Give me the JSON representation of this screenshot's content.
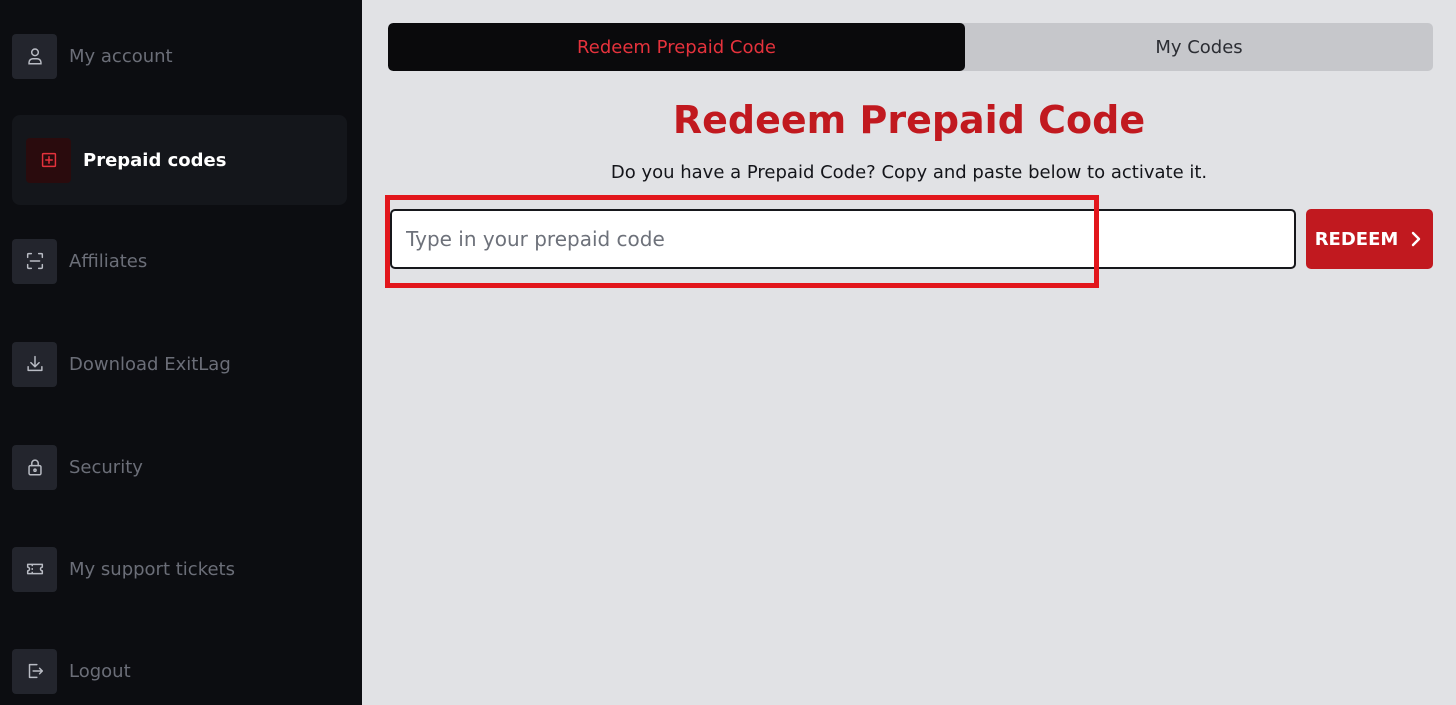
{
  "sidebar": {
    "items": [
      {
        "label": "My account",
        "icon": "user-icon"
      },
      {
        "label": "Prepaid codes",
        "icon": "plus-square-icon"
      },
      {
        "label": "Affiliates",
        "icon": "scan-icon"
      },
      {
        "label": "Download ExitLag",
        "icon": "download-icon"
      },
      {
        "label": "Security",
        "icon": "lock-icon"
      },
      {
        "label": "My support tickets",
        "icon": "ticket-icon"
      },
      {
        "label": "Logout",
        "icon": "logout-icon"
      }
    ]
  },
  "tabs": [
    {
      "label": "Redeem Prepaid Code",
      "active": true
    },
    {
      "label": "My Codes",
      "active": false
    }
  ],
  "main": {
    "title": "Redeem Prepaid Code",
    "subtitle": "Do you have a Prepaid Code? Copy and paste below to activate it.",
    "input": {
      "placeholder": "Type in your prepaid code",
      "value": ""
    },
    "redeem_label": "REDEEM"
  },
  "colors": {
    "accent": "#c1191f",
    "tab_active_text": "#e5323c",
    "highlight": "#e2161c",
    "sidebar_bg": "#0c0d11"
  }
}
